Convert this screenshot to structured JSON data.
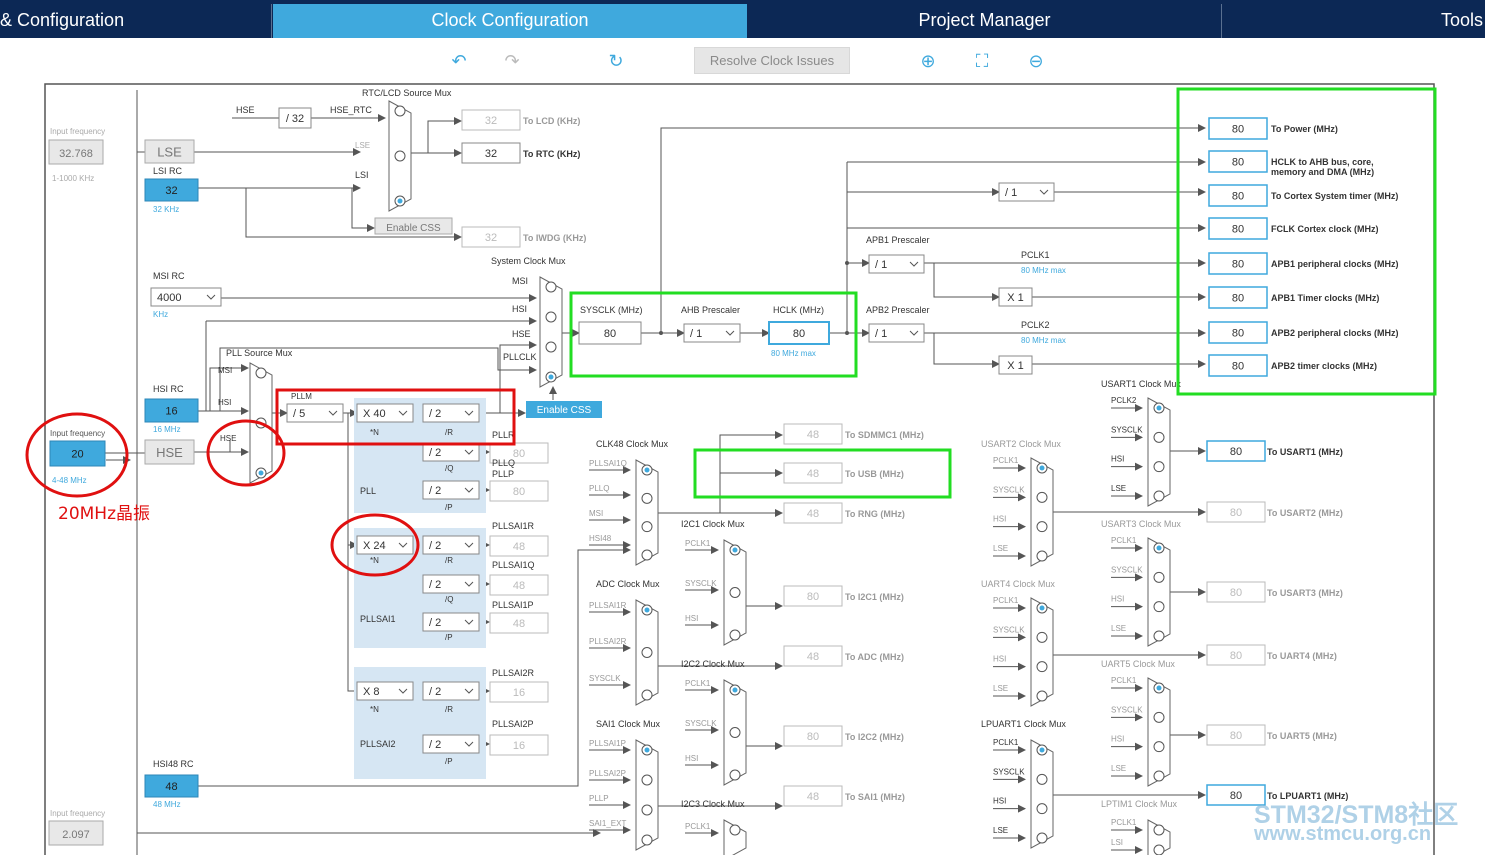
{
  "tabs": [
    {
      "label": "& Configuration",
      "active": false
    },
    {
      "label": "Clock Configuration",
      "active": true
    },
    {
      "label": "Project Manager",
      "active": false
    },
    {
      "label": "Tools",
      "active": false
    }
  ],
  "toolbar": {
    "resolve_label": "Resolve Clock Issues",
    "icons": [
      "undo-icon",
      "redo-icon",
      "reset-icon",
      "zoom-in-icon",
      "fit-icon",
      "zoom-out-icon"
    ]
  },
  "colors": {
    "accent": "#3fa9dd",
    "nav": "#0c2855",
    "highlight_red": "#e01010",
    "highlight_green": "#22dd22",
    "pll_area": "#d6e6f3"
  },
  "annotation": "20MHz晶振",
  "watermark": {
    "line1": "STM32/STM8社区",
    "line2": "www.stmcu.org.cn"
  },
  "sources": {
    "lse": {
      "input_label": "Input frequency",
      "value": "32.768",
      "range": "1-1000 KHz",
      "name": "LSE"
    },
    "lsi": {
      "title": "LSI RC",
      "value": "32",
      "unit": "32 KHz"
    },
    "msi": {
      "title": "MSI RC",
      "value": "4000",
      "unit": "KHz"
    },
    "hsi": {
      "title": "HSI RC",
      "value": "16",
      "unit": "16 MHz"
    },
    "hse": {
      "input_label": "Input frequency",
      "value": "20",
      "range": "4-48 MHz",
      "name": "HSE"
    },
    "hsi48": {
      "title": "HSI48 RC",
      "value": "48",
      "unit": "48 MHz"
    },
    "bottom": {
      "input_label": "Input frequency",
      "value": "2.097"
    }
  },
  "rtc": {
    "mux_title": "RTC/LCD Source Mux",
    "hse": "HSE",
    "div": "/ 32",
    "hse_rtc": "HSE_RTC",
    "lse": "LSE",
    "lsi": "LSI",
    "enable_css": "Enable CSS",
    "lcd_value": "32",
    "lcd_label": "To LCD (KHz)",
    "rtc_value": "32",
    "rtc_label": "To RTC (KHz)",
    "iwdg_value": "32",
    "iwdg_label": "To IWDG (KHz)"
  },
  "sysmux": {
    "title": "System Clock Mux",
    "inputs": [
      "MSI",
      "HSI",
      "HSE",
      "PLLCLK"
    ],
    "enable_css": "Enable CSS"
  },
  "pllmux": {
    "title": "PLL Source Mux",
    "inputs": [
      "MSI",
      "HSI",
      "HSE"
    ]
  },
  "pll": {
    "pllm_label": "PLLM",
    "pllm": "/ 5",
    "n": "X 40",
    "n_sub": "*N",
    "r": "/ 2",
    "r_sub": "/R",
    "r_out": "PLLR",
    "q": "/ 2",
    "q_sub": "/Q",
    "q_out": "PLLQ",
    "q_val": "80",
    "p": "/ 2",
    "p_sub": "/P",
    "p_out": "PLLP",
    "p_val": "80",
    "name": "PLL"
  },
  "pllsai1": {
    "n": "X 24",
    "n_sub": "*N",
    "r": "/ 2",
    "r_sub": "/R",
    "r_out": "PLLSAI1R",
    "r_val": "48",
    "q": "/ 2",
    "q_sub": "/Q",
    "q_out": "PLLSAI1Q",
    "q_val": "48",
    "p": "/ 2",
    "p_sub": "/P",
    "p_out": "PLLSAI1P",
    "p_val": "48",
    "name": "PLLSAI1"
  },
  "pllsai2": {
    "n": "X 8",
    "n_sub": "*N",
    "r": "/ 2",
    "r_sub": "/R",
    "r_out": "PLLSAI2R",
    "r_val": "16",
    "p": "/ 2",
    "p_sub": "/P",
    "p_out": "PLLSAI2P",
    "p_val": "16",
    "name": "PLLSAI2"
  },
  "bus": {
    "sysclk_label": "SYSCLK (MHz)",
    "sysclk": "80",
    "ahb_label": "AHB Prescaler",
    "ahb": "/ 1",
    "hclk_label": "HCLK (MHz)",
    "hclk": "80",
    "hclk_max": "80 MHz max",
    "cortex_div": "/ 1",
    "apb1_label": "APB1 Prescaler",
    "apb1": "/ 1",
    "pclk1": "PCLK1",
    "pclk1_max": "80 MHz max",
    "x1a": "X 1",
    "apb2_label": "APB2 Prescaler",
    "apb2": "/ 1",
    "pclk2": "PCLK2",
    "pclk2_max": "80 MHz max",
    "x1b": "X 1"
  },
  "outputs": [
    {
      "value": "80",
      "label": "To Power (MHz)"
    },
    {
      "value": "80",
      "label": "HCLK to AHB bus, core,",
      "label2": "memory and DMA (MHz)"
    },
    {
      "value": "80",
      "label": "To Cortex System timer (MHz)"
    },
    {
      "value": "80",
      "label": "FCLK Cortex clock (MHz)"
    },
    {
      "value": "80",
      "label": "APB1 peripheral clocks (MHz)"
    },
    {
      "value": "80",
      "label": "APB1 Timer clocks (MHz)"
    },
    {
      "value": "80",
      "label": "APB2 peripheral clocks (MHz)"
    },
    {
      "value": "80",
      "label": "APB2 timer clocks (MHz)"
    }
  ],
  "clk48": {
    "title": "CLK48 Clock Mux",
    "inputs": [
      "PLLSAI1Q",
      "PLLQ",
      "MSI",
      "HSI48"
    ]
  },
  "periph_mid": [
    {
      "value": "48",
      "label": "To SDMMC1 (MHz)"
    },
    {
      "value": "48",
      "label": "To USB (MHz)"
    },
    {
      "value": "48",
      "label": "To RNG (MHz)"
    },
    {
      "value": "80",
      "label": "To I2C1 (MHz)"
    },
    {
      "value": "48",
      "label": "To ADC (MHz)"
    },
    {
      "value": "80",
      "label": "To I2C2 (MHz)"
    },
    {
      "value": "48",
      "label": "To SAI1 (MHz)"
    }
  ],
  "muxes_mid": [
    {
      "title": "I2C1 Clock Mux",
      "inputs": [
        "PCLK1",
        "SYSCLK",
        "HSI"
      ]
    },
    {
      "title": "ADC Clock Mux",
      "inputs": [
        "PLLSAI1R",
        "PLLSAI2R",
        "SYSCLK"
      ]
    },
    {
      "title": "I2C2 Clock Mux",
      "inputs": [
        "PCLK1",
        "SYSCLK",
        "HSI"
      ]
    },
    {
      "title": "SAI1 Clock Mux",
      "inputs": [
        "PLLSAI1P",
        "PLLSAI2P",
        "PLLP",
        "SAI1_EXT"
      ]
    },
    {
      "title": "I2C3 Clock Mux",
      "inputs": [
        "PCLK1"
      ]
    }
  ],
  "muxes_right": [
    {
      "title": "USART1 Clock Mux",
      "inputs": [
        "PCLK2",
        "SYSCLK",
        "HSI",
        "LSE"
      ],
      "value": "80",
      "label": "To USART1 (MHz)"
    },
    {
      "title": "USART2 Clock Mux",
      "inputs": [
        "PCLK1",
        "SYSCLK",
        "HSI",
        "LSE"
      ],
      "value": "80",
      "label": "To USART2 (MHz)"
    },
    {
      "title": "USART3 Clock Mux",
      "inputs": [
        "PCLK1",
        "SYSCLK",
        "HSI",
        "LSE"
      ],
      "value": "80",
      "label": "To USART3 (MHz)"
    },
    {
      "title": "UART4 Clock Mux",
      "inputs": [
        "PCLK1",
        "SYSCLK",
        "HSI",
        "LSE"
      ],
      "value": "80",
      "label": "To UART4 (MHz)"
    },
    {
      "title": "UART5 Clock Mux",
      "inputs": [
        "PCLK1",
        "SYSCLK",
        "HSI",
        "LSE"
      ],
      "value": "80",
      "label": "To UART5 (MHz)"
    },
    {
      "title": "LPUART1 Clock Mux",
      "inputs": [
        "PCLK1",
        "SYSCLK",
        "HSI",
        "LSE"
      ],
      "value": "80",
      "label": "To LPUART1 (MHz)"
    },
    {
      "title": "LPTIM1 Clock Mux",
      "inputs": [
        "PCLK1",
        "LSI"
      ]
    }
  ]
}
